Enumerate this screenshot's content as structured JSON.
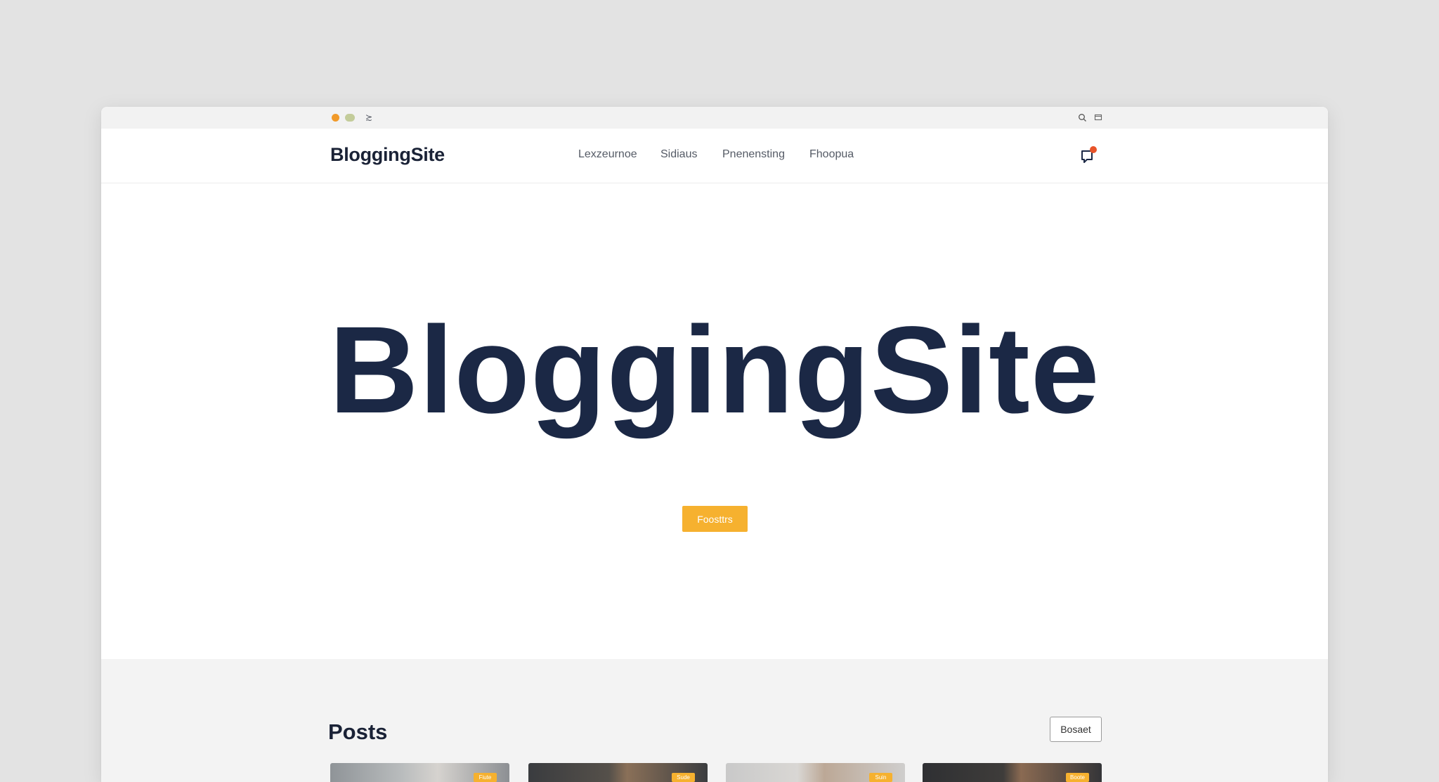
{
  "chrome": {
    "glyph": "≿"
  },
  "nav": {
    "brand": "BloggingSite",
    "links": [
      "Lexzeurnoe",
      "Sidiaus",
      "Pnenensting",
      "Fhoopua"
    ]
  },
  "hero": {
    "title": "BloggingSite",
    "button_label": "Foosttrs"
  },
  "posts": {
    "title": "Posts",
    "button_label": "Bosaet",
    "cards": [
      {
        "badge": "Fiute"
      },
      {
        "badge": "Sude"
      },
      {
        "badge": "Suin"
      },
      {
        "badge": "Boote"
      }
    ]
  },
  "colors": {
    "accent": "#f6b12f",
    "hero_text": "#1b2845",
    "notification": "#e8542a",
    "page_bg": "#e3e3e3"
  },
  "icons": {
    "chrome_search": "search-icon",
    "chrome_tab": "tab-icon",
    "notification": "bell-icon"
  }
}
